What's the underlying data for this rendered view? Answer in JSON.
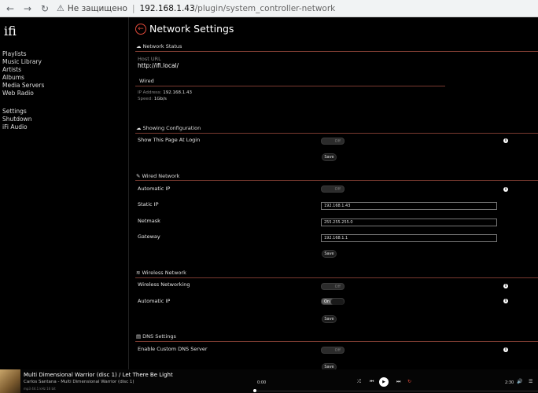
{
  "browser": {
    "security_warning_icon": "warning-triangle-icon",
    "security_label": "Не защищено",
    "url_host": "192.168.1.43",
    "url_path": "/plugin/system_controller-network"
  },
  "sidebar": {
    "logo": "ifi",
    "items": [
      {
        "label": "Playlists"
      },
      {
        "label": "Music Library"
      },
      {
        "label": "Artists"
      },
      {
        "label": "Albums"
      },
      {
        "label": "Media Servers"
      },
      {
        "label": "Web Radio"
      }
    ],
    "items2": [
      {
        "label": "Settings"
      },
      {
        "label": "Shutdown"
      },
      {
        "label": "iFi Audio"
      }
    ]
  },
  "page": {
    "title": "Network Settings"
  },
  "network_status": {
    "header": "Network Status",
    "host_url_label": "Host URL",
    "host_url_value": "http://ifi.local/",
    "wired_label": "Wired",
    "ip_label": "IP Address:",
    "ip_value": "192.168.1.43",
    "speed_label": "Speed:",
    "speed_value": "1Gb/s"
  },
  "showing_config": {
    "header": "Showing Configuration",
    "show_page_label": "Show This Page At Login",
    "toggle_off": "Off",
    "save_label": "Save"
  },
  "wired_network": {
    "header": "Wired Network",
    "automatic_ip_label": "Automatic IP",
    "toggle_off": "Off",
    "static_ip_label": "Static IP",
    "static_ip_value": "192.168.1.43",
    "netmask_label": "Netmask",
    "netmask_value": "255.255.255.0",
    "gateway_label": "Gateway",
    "gateway_value": "192.168.1.1",
    "save_label": "Save"
  },
  "wireless_network": {
    "header": "Wireless Network",
    "wireless_label": "Wireless Networking",
    "wireless_toggle": "Off",
    "automatic_ip_label": "Automatic IP",
    "automatic_ip_toggle": "On",
    "save_label": "Save"
  },
  "dns_settings": {
    "header": "DNS Settings",
    "custom_dns_label": "Enable Custom DNS Server",
    "toggle_off": "Off",
    "save_label": "Save"
  },
  "player": {
    "title": "Multi Dimensional Warrior (disc 1) / Let There Be Light",
    "artist_album": "Carlos Santana - Multi Dimensional Warrior (disc 1)",
    "format": "mp3 44.1 kHz 16 bit",
    "time_elapsed": "0:00",
    "time_total": "2:30",
    "progress": 0.005,
    "accent_color": "#e34b3b"
  }
}
